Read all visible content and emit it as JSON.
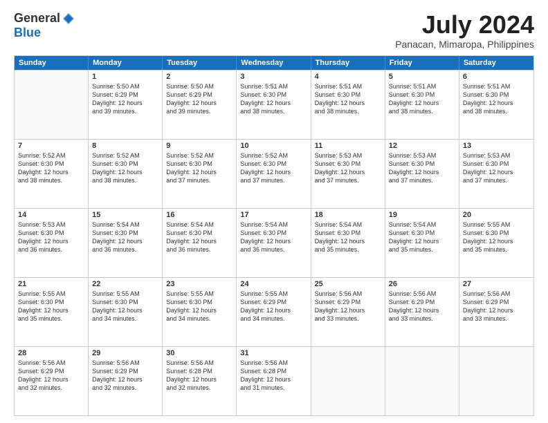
{
  "logo": {
    "general": "General",
    "blue": "Blue"
  },
  "title": "July 2024",
  "location": "Panacan, Mimaropa, Philippines",
  "header_days": [
    "Sunday",
    "Monday",
    "Tuesday",
    "Wednesday",
    "Thursday",
    "Friday",
    "Saturday"
  ],
  "rows": [
    [
      {
        "day": "",
        "text": ""
      },
      {
        "day": "1",
        "text": "Sunrise: 5:50 AM\nSunset: 6:29 PM\nDaylight: 12 hours\nand 39 minutes."
      },
      {
        "day": "2",
        "text": "Sunrise: 5:50 AM\nSunset: 6:29 PM\nDaylight: 12 hours\nand 39 minutes."
      },
      {
        "day": "3",
        "text": "Sunrise: 5:51 AM\nSunset: 6:30 PM\nDaylight: 12 hours\nand 38 minutes."
      },
      {
        "day": "4",
        "text": "Sunrise: 5:51 AM\nSunset: 6:30 PM\nDaylight: 12 hours\nand 38 minutes."
      },
      {
        "day": "5",
        "text": "Sunrise: 5:51 AM\nSunset: 6:30 PM\nDaylight: 12 hours\nand 38 minutes."
      },
      {
        "day": "6",
        "text": "Sunrise: 5:51 AM\nSunset: 6:30 PM\nDaylight: 12 hours\nand 38 minutes."
      }
    ],
    [
      {
        "day": "7",
        "text": "Sunrise: 5:52 AM\nSunset: 6:30 PM\nDaylight: 12 hours\nand 38 minutes."
      },
      {
        "day": "8",
        "text": "Sunrise: 5:52 AM\nSunset: 6:30 PM\nDaylight: 12 hours\nand 38 minutes."
      },
      {
        "day": "9",
        "text": "Sunrise: 5:52 AM\nSunset: 6:30 PM\nDaylight: 12 hours\nand 37 minutes."
      },
      {
        "day": "10",
        "text": "Sunrise: 5:52 AM\nSunset: 6:30 PM\nDaylight: 12 hours\nand 37 minutes."
      },
      {
        "day": "11",
        "text": "Sunrise: 5:53 AM\nSunset: 6:30 PM\nDaylight: 12 hours\nand 37 minutes."
      },
      {
        "day": "12",
        "text": "Sunrise: 5:53 AM\nSunset: 6:30 PM\nDaylight: 12 hours\nand 37 minutes."
      },
      {
        "day": "13",
        "text": "Sunrise: 5:53 AM\nSunset: 6:30 PM\nDaylight: 12 hours\nand 37 minutes."
      }
    ],
    [
      {
        "day": "14",
        "text": "Sunrise: 5:53 AM\nSunset: 6:30 PM\nDaylight: 12 hours\nand 36 minutes."
      },
      {
        "day": "15",
        "text": "Sunrise: 5:54 AM\nSunset: 6:30 PM\nDaylight: 12 hours\nand 36 minutes."
      },
      {
        "day": "16",
        "text": "Sunrise: 5:54 AM\nSunset: 6:30 PM\nDaylight: 12 hours\nand 36 minutes."
      },
      {
        "day": "17",
        "text": "Sunrise: 5:54 AM\nSunset: 6:30 PM\nDaylight: 12 hours\nand 36 minutes."
      },
      {
        "day": "18",
        "text": "Sunrise: 5:54 AM\nSunset: 6:30 PM\nDaylight: 12 hours\nand 35 minutes."
      },
      {
        "day": "19",
        "text": "Sunrise: 5:54 AM\nSunset: 6:30 PM\nDaylight: 12 hours\nand 35 minutes."
      },
      {
        "day": "20",
        "text": "Sunrise: 5:55 AM\nSunset: 6:30 PM\nDaylight: 12 hours\nand 35 minutes."
      }
    ],
    [
      {
        "day": "21",
        "text": "Sunrise: 5:55 AM\nSunset: 6:30 PM\nDaylight: 12 hours\nand 35 minutes."
      },
      {
        "day": "22",
        "text": "Sunrise: 5:55 AM\nSunset: 6:30 PM\nDaylight: 12 hours\nand 34 minutes."
      },
      {
        "day": "23",
        "text": "Sunrise: 5:55 AM\nSunset: 6:30 PM\nDaylight: 12 hours\nand 34 minutes."
      },
      {
        "day": "24",
        "text": "Sunrise: 5:55 AM\nSunset: 6:29 PM\nDaylight: 12 hours\nand 34 minutes."
      },
      {
        "day": "25",
        "text": "Sunrise: 5:56 AM\nSunset: 6:29 PM\nDaylight: 12 hours\nand 33 minutes."
      },
      {
        "day": "26",
        "text": "Sunrise: 5:56 AM\nSunset: 6:29 PM\nDaylight: 12 hours\nand 33 minutes."
      },
      {
        "day": "27",
        "text": "Sunrise: 5:56 AM\nSunset: 6:29 PM\nDaylight: 12 hours\nand 33 minutes."
      }
    ],
    [
      {
        "day": "28",
        "text": "Sunrise: 5:56 AM\nSunset: 6:29 PM\nDaylight: 12 hours\nand 32 minutes."
      },
      {
        "day": "29",
        "text": "Sunrise: 5:56 AM\nSunset: 6:29 PM\nDaylight: 12 hours\nand 32 minutes."
      },
      {
        "day": "30",
        "text": "Sunrise: 5:56 AM\nSunset: 6:28 PM\nDaylight: 12 hours\nand 32 minutes."
      },
      {
        "day": "31",
        "text": "Sunrise: 5:56 AM\nSunset: 6:28 PM\nDaylight: 12 hours\nand 31 minutes."
      },
      {
        "day": "",
        "text": ""
      },
      {
        "day": "",
        "text": ""
      },
      {
        "day": "",
        "text": ""
      }
    ]
  ]
}
